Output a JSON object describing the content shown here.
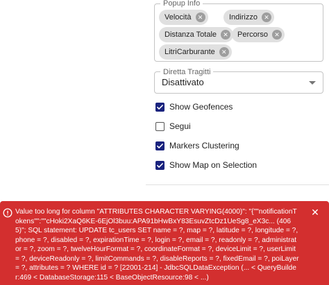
{
  "popup_info": {
    "legend": "Popup Info",
    "chips": [
      {
        "label": "Velocità"
      },
      {
        "label": "Indirizzo"
      },
      {
        "label": "Distanza Totale"
      },
      {
        "label": "Percorso"
      },
      {
        "label": "LitriCarburante"
      }
    ]
  },
  "direction_select": {
    "legend": "Diretta Tragitti",
    "value": "Disattivato"
  },
  "checkboxes": [
    {
      "label": "Show Geofences",
      "checked": true
    },
    {
      "label": "Segui",
      "checked": false
    },
    {
      "label": "Markers Clustering",
      "checked": true
    },
    {
      "label": "Show Map on Selection",
      "checked": true
    }
  ],
  "error": {
    "message": "Value too long for column \"ATTRIBUTES CHARACTER VARYING(4000)\": \"{\"\"notificationTokens\"\":\"\"cHoki2XaQ6KE-6EjOl3buu:APA91bHwBxY83EsuvZtcDz1UeSg8_eX3c... (4065)\"; SQL statement: UPDATE tc_users SET name = ?, map = ?, latitude = ?, longitude = ?, phone = ?, disabled = ?, expirationTime = ?, login = ?, email = ?, readonly = ?, administrator = ?, zoom = ?, twelveHourFormat = ?, coordinateFormat = ?, deviceLimit = ?, userLimit = ?, deviceReadonly = ?, limitCommands = ?, disableReports = ?, fixedEmail = ?, poiLayer = ?, attributes = ? WHERE id = ? [22001-214] - JdbcSQLDataException (... < QueryBuilder:469 < DatabaseStorage:115 < BaseObjectResource:98 < ...)"
  },
  "icons": {
    "error": "error-circle-icon",
    "close": "close-icon",
    "chip_delete": "cancel-circle-icon",
    "check": "check-icon",
    "dropdown": "arrow-drop-down-icon"
  },
  "colors": {
    "error_bg": "#d32f2f",
    "checkbox_on": "#1a237e",
    "chip_bg": "#e0e0e0"
  }
}
